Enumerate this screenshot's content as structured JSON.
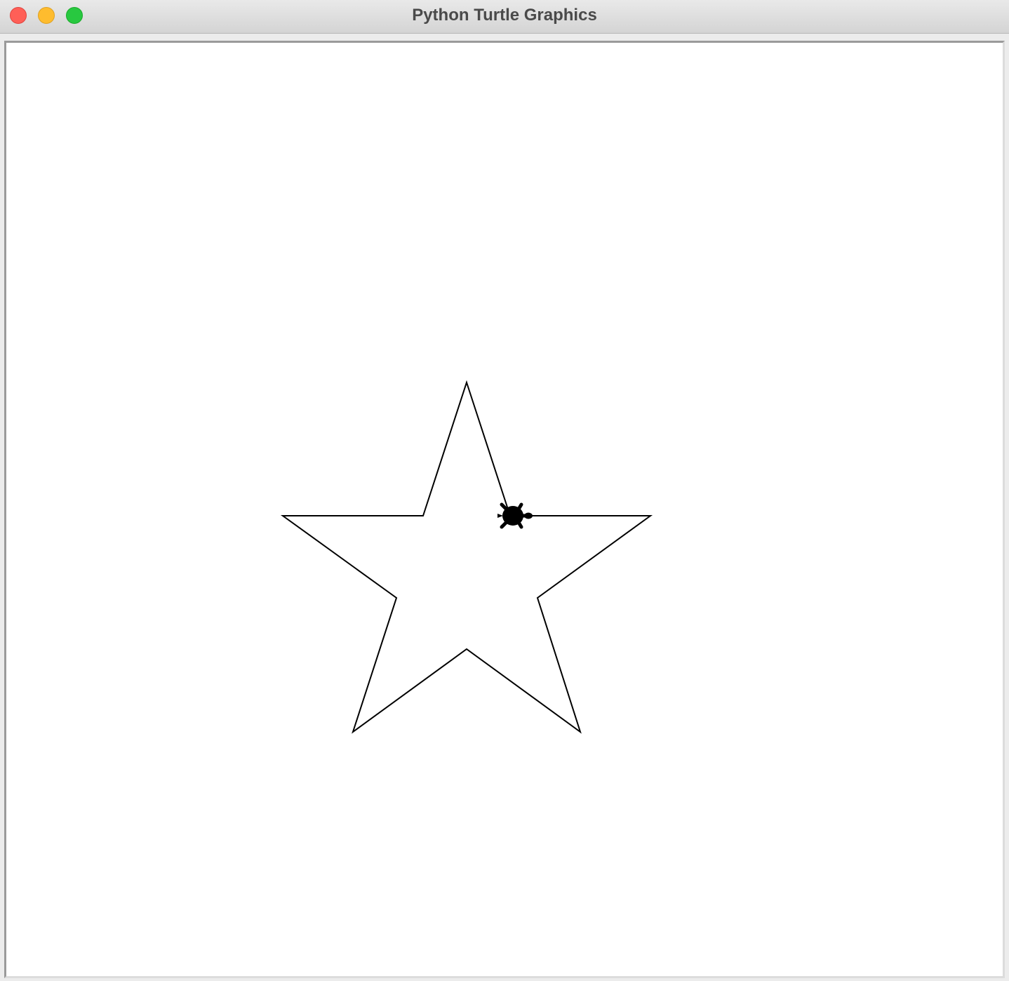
{
  "window": {
    "title": "Python Turtle Graphics"
  },
  "controls": {
    "close_color": "#ff5f57",
    "minimize_color": "#febc2e",
    "zoom_color": "#28c840"
  },
  "canvas": {
    "background": "#ffffff",
    "star": {
      "stroke": "#000000",
      "points": 5
    },
    "turtle": {
      "shape": "turtle-icon",
      "color": "#000000",
      "heading_deg": 0
    }
  }
}
